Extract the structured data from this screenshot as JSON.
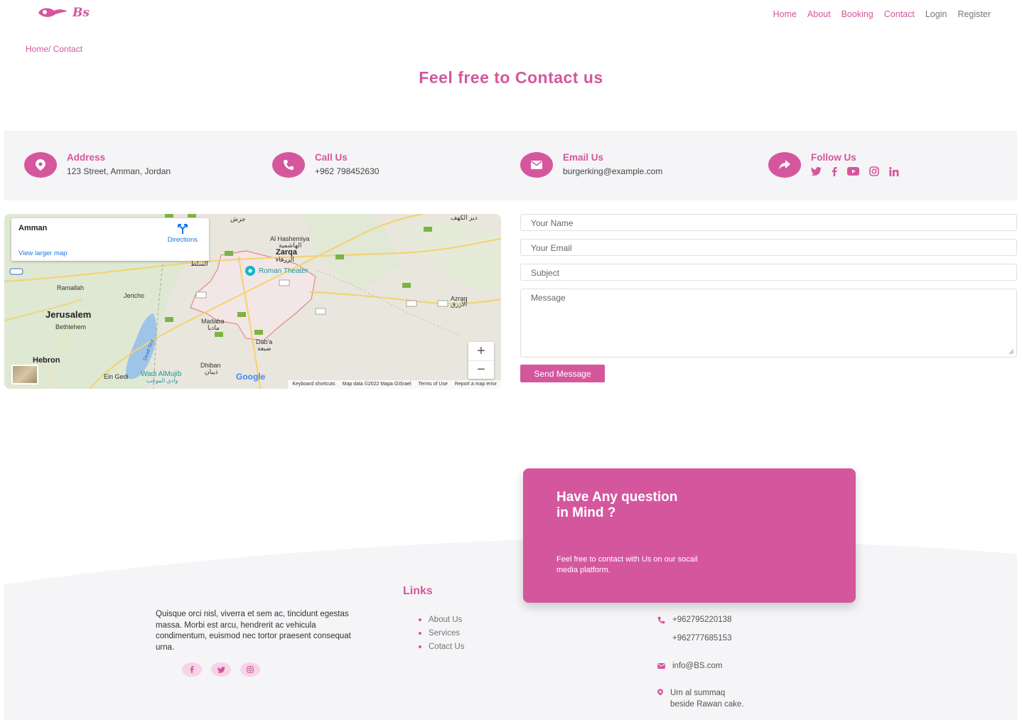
{
  "brand": {
    "logo_text": "Bs",
    "accent": "#d4579e"
  },
  "nav": {
    "links": [
      "Home",
      "About",
      "Booking",
      "Contact",
      "Login",
      "Register"
    ]
  },
  "breadcrumb": "Home/ Contact",
  "page_title": "Feel free to Contact us",
  "info": {
    "address": {
      "title": "Address",
      "text": "123 Street, Amman, Jordan",
      "icon": "map-pin-icon"
    },
    "call": {
      "title": "Call Us",
      "text": "+962 798452630",
      "icon": "phone-icon"
    },
    "email": {
      "title": "Email Us",
      "text": "burgerking@example.com",
      "icon": "envelope-icon"
    },
    "follow": {
      "title": "Follow Us",
      "icon": "share-icon",
      "networks": [
        "twitter",
        "facebook",
        "youtube",
        "instagram",
        "linkedin"
      ]
    }
  },
  "map": {
    "place": "Amman",
    "directions": "Directions",
    "view_larger": "View larger map",
    "labels": {
      "jerusalem": "Jerusalem",
      "bethlehem": "Bethlehem",
      "ramallah": "Ramallah",
      "jericho": "Jericho",
      "hebron": "Hebron",
      "ein_gedi": "Ein Gedi",
      "madaba": "Madaba",
      "madaba_ar": "مادبا",
      "zarqa": "Zarqa",
      "zarqa_ar": "الزرقاء",
      "al_hashemiya": "Al Hashemiya",
      "al_hashemiya_ar": "الهاشمية",
      "roman_theater": "Roman Theater",
      "dhiban": "Dhiban",
      "dhiban_ar": "ذيبان",
      "daba": "Dab'a",
      "daba_ar": "ضبعة",
      "azraq": "Azraq",
      "azraq_ar": "الأزرق",
      "wadi_almujib": "Wadi AlMujib",
      "wadi_almujib_ar": "وادي الموجب",
      "jerash": "جرش",
      "deir_kahf": "دير الكهف",
      "salt": "السلط",
      "dead_sea": "Dead Sea"
    },
    "zoom_in": "+",
    "zoom_out": "−",
    "google": "Google",
    "footer": [
      "Keyboard shortcuts",
      "Map data ©2022 Mapa GISrael",
      "Terms of Use",
      "Report a map error"
    ]
  },
  "form": {
    "name_placeholder": "Your Name",
    "email_placeholder": "Your Email",
    "subject_placeholder": "Subject",
    "message_placeholder": "Message",
    "send_label": "Send Message"
  },
  "question_card": {
    "title": "Have Any question in Mind ?",
    "text": "Feel free to contact with Us on our socail media platform."
  },
  "footer": {
    "about": "Quisque orci nisl, viverra et sem ac, tincidunt egestas massa. Morbi est arcu, hendrerit ac vehicula condimentum, euismod nec tortor praesent consequat urna.",
    "links_title": "Links",
    "links": [
      "About Us",
      "Services",
      "Cotact Us"
    ],
    "phone1": "+962795220138",
    "phone2": "+962777685153",
    "email": "info@BS.com",
    "address_line1": "Um al summaq",
    "address_line2": "beside Rawan cake."
  }
}
